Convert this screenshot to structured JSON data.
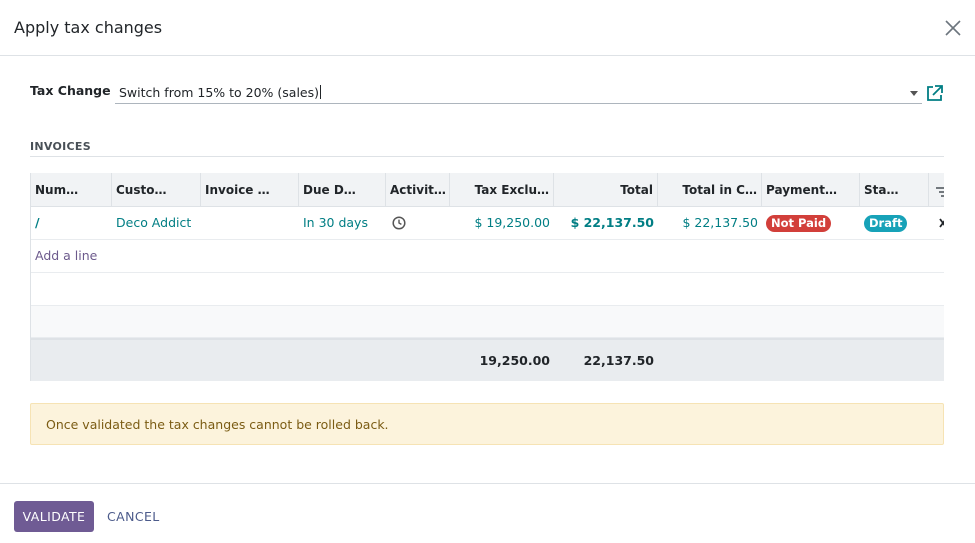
{
  "dialog": {
    "title": "Apply tax changes"
  },
  "field": {
    "label": "Tax Change",
    "value": "Switch from 15% to 20% (sales)"
  },
  "invoices": {
    "section_title": "INVOICES",
    "columns": [
      "Num…",
      "Custo…",
      "Invoice …",
      "Due D…",
      "Activit…",
      "Tax Exclu…",
      "Total",
      "Total in C…",
      "Payment…",
      "Sta…"
    ],
    "rows": [
      {
        "number": "/",
        "customer": "Deco Addict",
        "invoice_date": "",
        "due_date": "In 30 days",
        "activity_icon": "clock-icon",
        "tax_excluded": "$ 19,250.00",
        "total": "$ 22,137.50",
        "total_currency": "$ 22,137.50",
        "payment_status": "Not Paid",
        "status": "Draft"
      }
    ],
    "add_line_label": "Add a line",
    "totals": {
      "tax_excluded": "19,250.00",
      "total": "22,137.50"
    }
  },
  "alert": {
    "text": "Once validated the tax changes cannot be rolled back."
  },
  "footer": {
    "validate_label": "VALIDATE",
    "cancel_label": "CANCEL"
  },
  "colors": {
    "primary": "#6f5b94",
    "link": "#017e84",
    "danger": "#d23f3a",
    "info": "#17a2b8",
    "warning_bg": "#fcf3dc"
  }
}
